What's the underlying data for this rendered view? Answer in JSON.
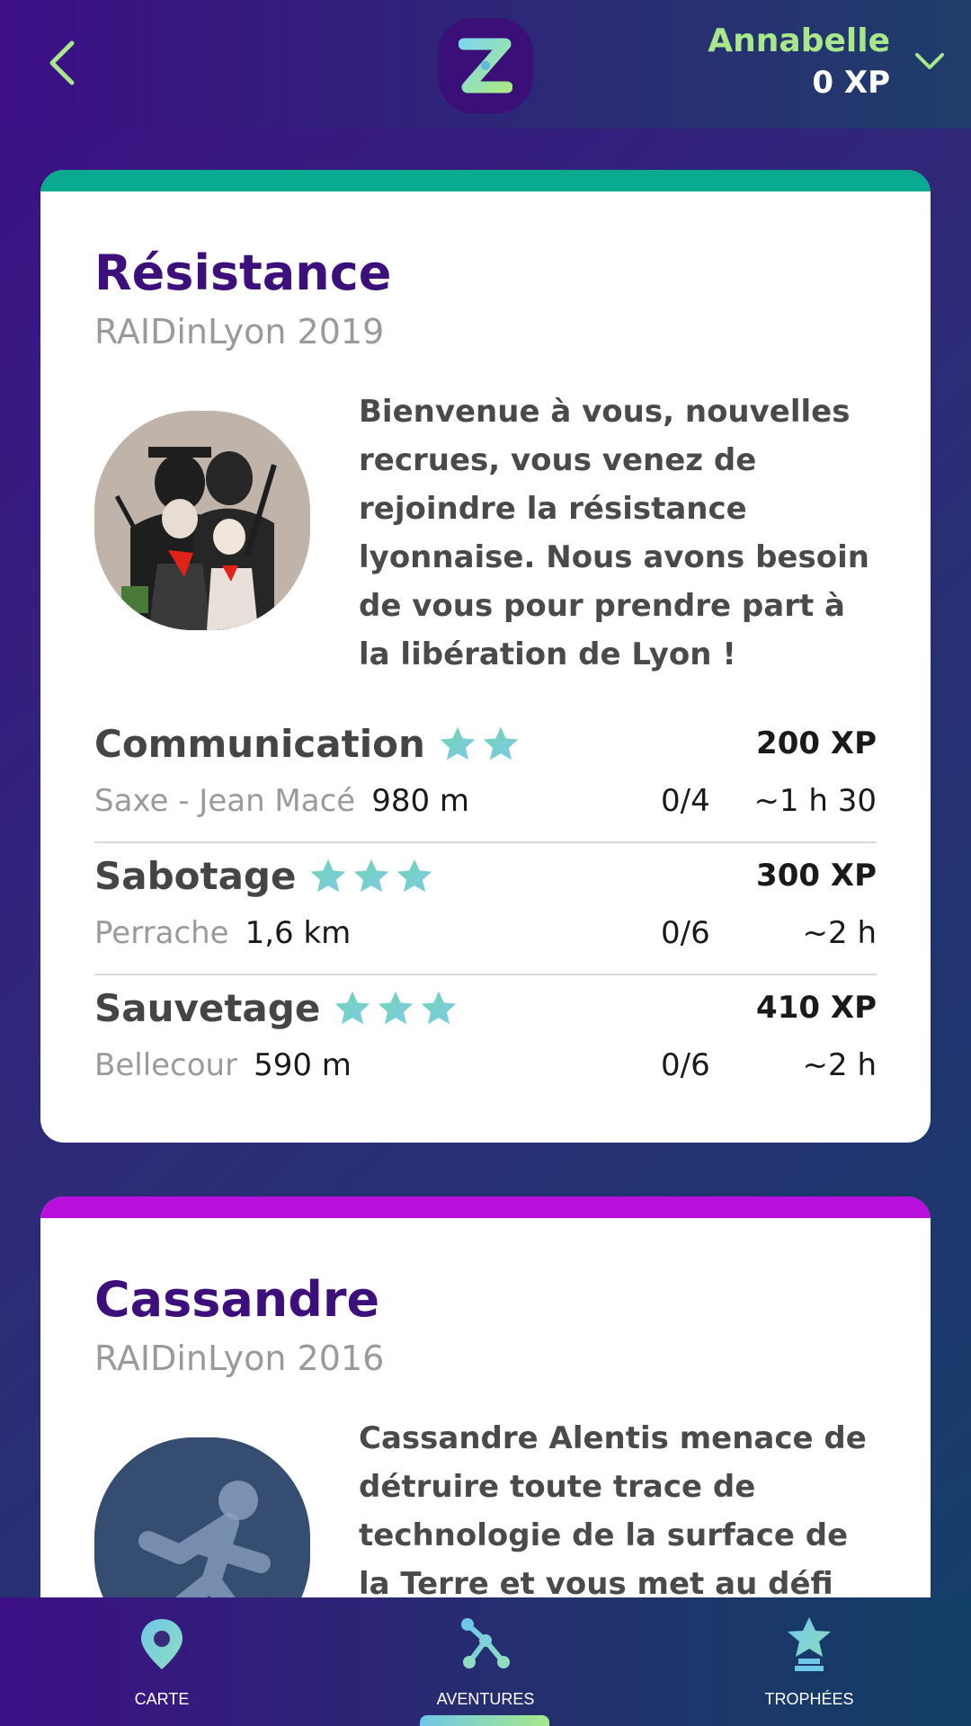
{
  "header": {
    "back_icon": "chevron-left-icon",
    "logo_letter": "Z",
    "user_name": "Annabelle",
    "user_xp": "0 XP",
    "toggle_icon": "chevron-down-icon"
  },
  "colors": {
    "accent_green": "#a8e88a",
    "title_purple": "#3d0f7a",
    "card1_top": "#0aaa90",
    "card2_top": "#b90fdc",
    "star_gradient": [
      "#6fd6b0",
      "#7fc8e8"
    ]
  },
  "adventures": [
    {
      "title": "Résistance",
      "subtitle": "RAIDinLyon 2019",
      "description": "Bienvenue à vous, nouvelles recrues, vous venez de rejoindre la résistance lyonnaise. Nous avons besoin de vous pour prendre part à la libération de Lyon !",
      "missions": [
        {
          "name": "Communication",
          "stars": 2,
          "xp": "200 XP",
          "location": "Saxe - Jean Macé",
          "distance": "980 m",
          "progress": "0/4",
          "duration": "~1 h 30"
        },
        {
          "name": "Sabotage",
          "stars": 3,
          "xp": "300 XP",
          "location": "Perrache",
          "distance": "1,6 km",
          "progress": "0/6",
          "duration": "~2 h"
        },
        {
          "name": "Sauvetage",
          "stars": 3,
          "xp": "410 XP",
          "location": "Bellecour",
          "distance": "590 m",
          "progress": "0/6",
          "duration": "~2 h"
        }
      ]
    },
    {
      "title": "Cassandre",
      "subtitle": "RAIDinLyon 2016",
      "description": "Cassandre Alentis menace de détruire toute trace de technologie de la surface de la Terre et vous met au défi de"
    }
  ],
  "nav": {
    "items": [
      {
        "label": "CARTE",
        "icon": "map-pin-icon"
      },
      {
        "label": "AVENTURES",
        "icon": "share-nodes-icon"
      },
      {
        "label": "TROPHÉES",
        "icon": "trophy-icon"
      }
    ],
    "active": "AVENTURES"
  }
}
